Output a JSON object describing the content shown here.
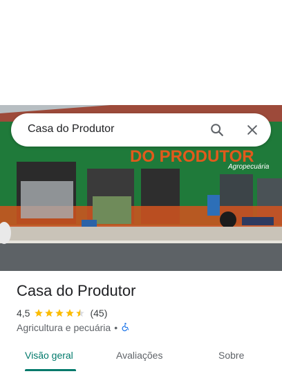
{
  "search": {
    "query": "Casa do Produtor"
  },
  "photo": {
    "sign_text": "DO PRODUTOR",
    "sign_subtext": "Agropecuária",
    "brand_green": "#1f7a3a",
    "sign_orange": "#e25a1c"
  },
  "place": {
    "name": "Casa do Produtor",
    "rating": "4,5",
    "stars_filled": 4.5,
    "reviews": "(45)",
    "category": "Agricultura e pecuária",
    "separator": "•"
  },
  "tabs": [
    {
      "label": "Visão geral",
      "active": true
    },
    {
      "label": "Avaliações",
      "active": false
    },
    {
      "label": "Sobre",
      "active": false
    }
  ],
  "colors": {
    "accent": "#00796b",
    "star": "#fbbc04"
  },
  "icons": [
    "search-icon",
    "close-icon",
    "star-icon",
    "wheelchair-icon"
  ]
}
